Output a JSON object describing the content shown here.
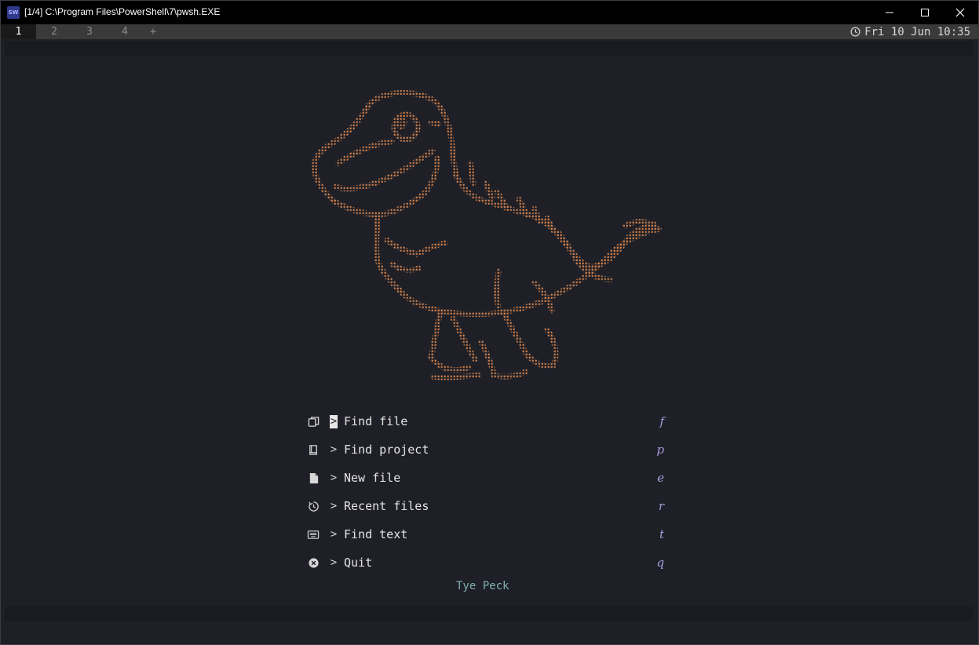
{
  "window": {
    "title": "[1/4] C:\\Program Files\\PowerShell\\7\\pwsh.EXE",
    "app_icon": "SW"
  },
  "tabs": [
    {
      "label": "1",
      "active": true
    },
    {
      "label": "2",
      "active": false
    },
    {
      "label": "3",
      "active": false
    },
    {
      "label": "4",
      "active": false
    },
    {
      "label": "+",
      "active": false
    }
  ],
  "clock": {
    "icon": "clock-icon",
    "text": "Fri 10 Jun 10:35"
  },
  "menu": {
    "items": [
      {
        "icon": "files-icon",
        "arrow": ">",
        "label": "Find file",
        "key": "f"
      },
      {
        "icon": "book-icon",
        "arrow": ">",
        "label": "Find project",
        "key": "p"
      },
      {
        "icon": "file-icon",
        "arrow": ">",
        "label": "New file",
        "key": "e"
      },
      {
        "icon": "history-icon",
        "arrow": ">",
        "label": "Recent files",
        "key": "r"
      },
      {
        "icon": "keyboard-icon",
        "arrow": ">",
        "label": "Find text",
        "key": "t"
      },
      {
        "icon": "close-circle-icon",
        "arrow": ">",
        "label": "Quit",
        "key": "q"
      }
    ]
  },
  "footer": {
    "author": "Tye Peck"
  },
  "colors": {
    "background": "#1f2027",
    "dino": "#e08a4f",
    "key": "#a49ad8",
    "author": "#7fb1ae"
  }
}
